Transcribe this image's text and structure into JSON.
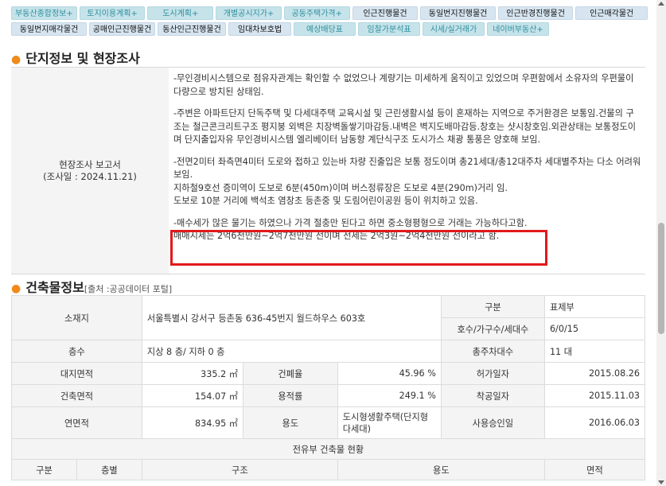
{
  "tabs": {
    "row1": [
      {
        "label": "부동산종합정보+",
        "style": "plus"
      },
      {
        "label": "토지이용계획+",
        "style": "plus"
      },
      {
        "label": "도시계획+",
        "style": "plus"
      },
      {
        "label": "개별공시지가+",
        "style": "plus"
      },
      {
        "label": "공동주택가격+",
        "style": "plus"
      },
      {
        "label": "인근진행물건",
        "style": "dark"
      },
      {
        "label": "동일번지진행물건",
        "style": "dark"
      },
      {
        "label": "인근반경진행물건",
        "style": "dark"
      },
      {
        "label": "인근매각물건",
        "style": "dark"
      }
    ],
    "row2": [
      {
        "label": "동일번지매각물건",
        "style": "dark"
      },
      {
        "label": "공매인근진행물건",
        "style": "dark"
      },
      {
        "label": "동산인근진행물건",
        "style": "dark"
      },
      {
        "label": "임대차보호법",
        "style": "dark"
      },
      {
        "label": "예상배당표",
        "style": "plus"
      },
      {
        "label": "임찰가분석표",
        "style": "plus"
      },
      {
        "label": "시세/실거래가",
        "style": "plus"
      },
      {
        "label": "네이버부동산+",
        "style": "plus"
      }
    ]
  },
  "survey": {
    "title": "단지정보 및 현장조사",
    "label_line1": "현장조사 보고서",
    "label_line2": "(조사일 : 2024.11.21)",
    "paragraphs": [
      "-무인경비시스템으로 점유자관계는 확인할 수 없었으나 계량기는 미세하게 움직이고 있었으며 우편함에서 소유자의 우편물이 다량으로 방치된 상태임.",
      "-주변은 아파트단지 단독주택 및 다세대주택 교육시설 및 근린생활시설 등이 혼재하는 지역으로 주거환경은 보통임.건물의 구조는 철근콘크리트구조 평지붕 외벽은 치장벽돌쌓기마감등.내벽은 벽지도배마감등.창호는 샷시창호임.외관상태는 보통정도이며 단지출입자유 무인경비시스템 엘리베이터 남동향 계단식구조 도시가스 채광 통풍은 양호해 보임.",
      "-전면2미터 좌측면4미터 도로와 접하고 있는바 차량 진출입은 보통 정도이며 총21세대/총12대주차 세대별주차는 다소 어려워 보임.",
      "지하철9호선 증미역이 도보로 6분(450m)이며 버스정류장은 도보로 4분(290m)거리 임.",
      "도보로 10분 거리에 백석초 염창초 등촌중 및 도림어린이공원 등이 위치하고 있음.",
      "-매수세가 많은 물기는 하였으나 가격 절충만 된다고 하면 중소형평형으로 거래는 가능하다고함.",
      "매매시세는 2억6천만원~2억7천만원 선이며 전세는 2억3원~2억4천만원 선이라고 함."
    ]
  },
  "building": {
    "title": "건축물정보",
    "source": "[출처 :공공데이터 포털]",
    "location_label": "소재지",
    "location_value": "서울특별시 강서구 등촌동 636-45번지 월드하우스 603호",
    "type_label": "구분",
    "type_value": "표제부",
    "units_label": "호수/가구수/세대수",
    "units_value": "6/0/15",
    "floors_label": "층수",
    "floors_value": "지상 8 층/ 지하 0 층",
    "parking_label": "총주차대수",
    "parking_value": "11 대",
    "site_area_label": "대지면적",
    "site_area_value": "335.2 ㎡",
    "coverage_label": "건폐율",
    "coverage_value": "45.96 %",
    "permit_label": "허가일자",
    "permit_value": "2015.08.26",
    "building_area_label": "건축면적",
    "building_area_value": "154.07 ㎡",
    "far_label": "용적률",
    "far_value": "249.1 %",
    "start_label": "착공일자",
    "start_value": "2015.11.03",
    "total_area_label": "연면적",
    "total_area_value": "834.95 ㎡",
    "use_label": "용도",
    "use_value": "도시형생활주택(단지형다세대)",
    "approval_label": "사용승인일",
    "approval_value": "2016.06.03",
    "exclusive_caption": "전유부 건축물 현황",
    "exclusive_headers": [
      "구분",
      "층별",
      "구조",
      "용도",
      "면적"
    ]
  }
}
